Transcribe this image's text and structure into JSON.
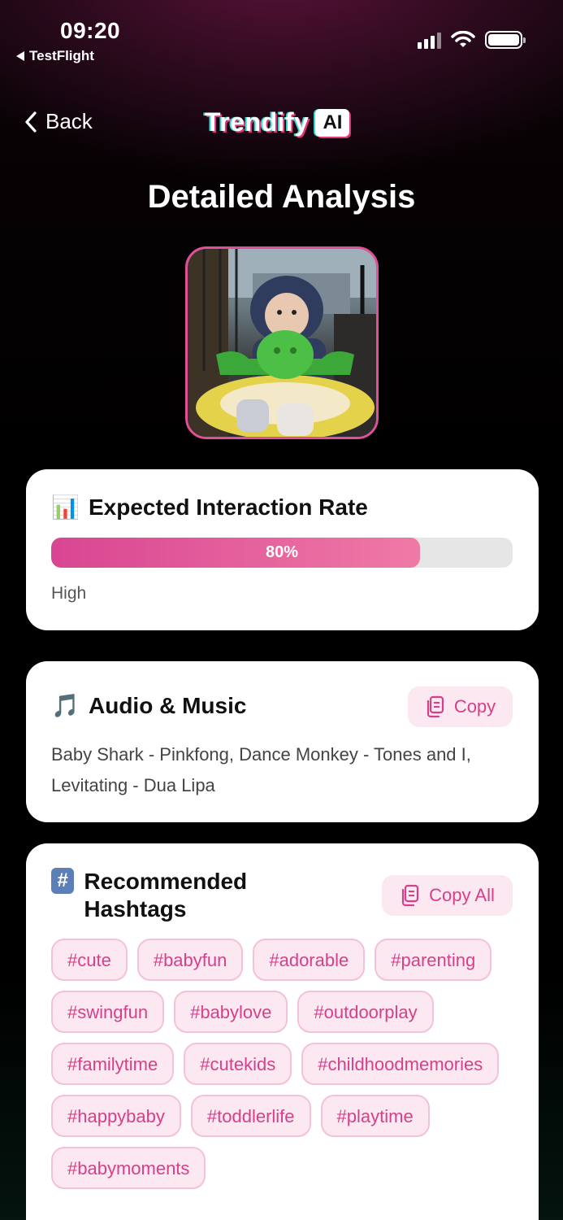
{
  "status_bar": {
    "time": "09:20",
    "back_app": "TestFlight"
  },
  "nav": {
    "back_label": "Back",
    "logo_text": "Trendify",
    "logo_badge": "AI"
  },
  "page": {
    "title": "Detailed Analysis"
  },
  "interaction": {
    "emoji": "📊",
    "title": "Expected Interaction Rate",
    "progress": 0.8,
    "progress_label": "80%",
    "level": "High"
  },
  "audio": {
    "emoji": "🎵",
    "title": "Audio & Music",
    "copy_label": "Copy",
    "text": "Baby Shark - Pinkfong, Dance Monkey - Tones and I, Levitating - Dua Lipa"
  },
  "hashtags": {
    "emoji": "#",
    "title": "Recommended Hashtags",
    "copy_label": "Copy All",
    "tags": [
      "#cute",
      "#babyfun",
      "#adorable",
      "#parenting",
      "#swingfun",
      "#babylove",
      "#outdoorplay",
      "#familytime",
      "#cutekids",
      "#childhoodmemories",
      "#happybaby",
      "#toddlerlife",
      "#playtime",
      "#babymoments"
    ]
  },
  "colors": {
    "accent": "#d6408a",
    "tag_bg": "#fbe8f1",
    "progress_start": "#d94592",
    "progress_end": "#ef7aa6"
  }
}
